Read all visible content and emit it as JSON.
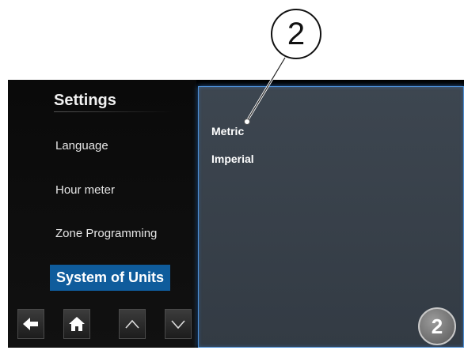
{
  "callout": {
    "label": "2"
  },
  "sidebar": {
    "title": "Settings",
    "items": [
      {
        "label": "Language"
      },
      {
        "label": "Hour meter"
      },
      {
        "label": "Zone Programming"
      },
      {
        "label": "System of Units",
        "selected": true
      }
    ]
  },
  "nav": {
    "buttons": [
      {
        "icon": "arrow-left-icon"
      },
      {
        "icon": "home-icon"
      },
      {
        "icon": "chevron-up-icon"
      },
      {
        "icon": "chevron-down-icon"
      }
    ]
  },
  "units": {
    "options": [
      {
        "label": "Metric"
      },
      {
        "label": "Imperial"
      }
    ]
  },
  "page_badge": {
    "label": "2"
  },
  "colors": {
    "selected_bg": "#0f5c9c",
    "panel_border": "#4d8fd6",
    "panel_bg": "#3d4650"
  }
}
